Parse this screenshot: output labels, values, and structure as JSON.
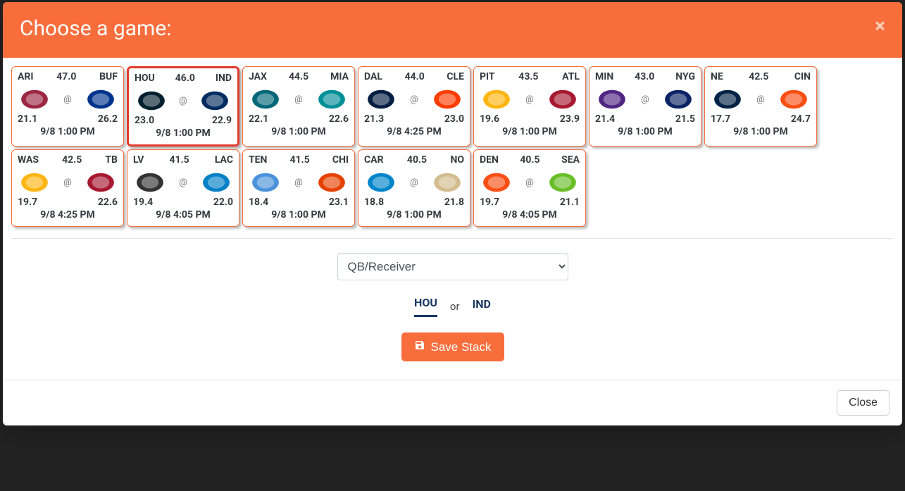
{
  "modal": {
    "title": "Choose a game:",
    "close_x": "×"
  },
  "games": [
    {
      "away": "ARI",
      "home": "BUF",
      "total": "47.0",
      "away_pts": "21.1",
      "home_pts": "26.2",
      "time": "9/8 1:00 PM",
      "selected": false,
      "ac": "#9b2743",
      "hc": "#00338d"
    },
    {
      "away": "HOU",
      "home": "IND",
      "total": "46.0",
      "away_pts": "23.0",
      "home_pts": "22.9",
      "time": "9/8 1:00 PM",
      "selected": true,
      "ac": "#03202f",
      "hc": "#002c5f"
    },
    {
      "away": "JAX",
      "home": "MIA",
      "total": "44.5",
      "away_pts": "22.1",
      "home_pts": "22.6",
      "time": "9/8 1:00 PM",
      "selected": false,
      "ac": "#006778",
      "hc": "#008e97"
    },
    {
      "away": "DAL",
      "home": "CLE",
      "total": "44.0",
      "away_pts": "21.3",
      "home_pts": "23.0",
      "time": "9/8 4:25 PM",
      "selected": false,
      "ac": "#041e42",
      "hc": "#ff3c00"
    },
    {
      "away": "PIT",
      "home": "ATL",
      "total": "43.5",
      "away_pts": "19.6",
      "home_pts": "23.9",
      "time": "9/8 1:00 PM",
      "selected": false,
      "ac": "#ffb612",
      "hc": "#a71930"
    },
    {
      "away": "MIN",
      "home": "NYG",
      "total": "43.0",
      "away_pts": "21.4",
      "home_pts": "21.5",
      "time": "9/8 1:00 PM",
      "selected": false,
      "ac": "#4f2683",
      "hc": "#0b2265"
    },
    {
      "away": "NE",
      "home": "CIN",
      "total": "42.5",
      "away_pts": "17.7",
      "home_pts": "24.7",
      "time": "9/8 1:00 PM",
      "selected": false,
      "ac": "#002244",
      "hc": "#fb4f14"
    },
    {
      "away": "WAS",
      "home": "TB",
      "total": "42.5",
      "away_pts": "19.7",
      "home_pts": "22.6",
      "time": "9/8 4:25 PM",
      "selected": false,
      "ac": "#ffb612",
      "hc": "#a71930"
    },
    {
      "away": "LV",
      "home": "LAC",
      "total": "41.5",
      "away_pts": "19.4",
      "home_pts": "22.0",
      "time": "9/8 4:05 PM",
      "selected": false,
      "ac": "#333333",
      "hc": "#0080c6"
    },
    {
      "away": "TEN",
      "home": "CHI",
      "total": "41.5",
      "away_pts": "18.4",
      "home_pts": "23.1",
      "time": "9/8 1:00 PM",
      "selected": false,
      "ac": "#4b92db",
      "hc": "#e64100"
    },
    {
      "away": "CAR",
      "home": "NO",
      "total": "40.5",
      "away_pts": "18.8",
      "home_pts": "21.8",
      "time": "9/8 1:00 PM",
      "selected": false,
      "ac": "#0085ca",
      "hc": "#d3bc8d"
    },
    {
      "away": "DEN",
      "home": "SEA",
      "total": "40.5",
      "away_pts": "19.7",
      "home_pts": "21.1",
      "time": "9/8 4:05 PM",
      "selected": false,
      "ac": "#fb4f14",
      "hc": "#69be28"
    }
  ],
  "at_symbol": "@",
  "stack_select": {
    "selected": "QB/Receiver"
  },
  "team_tabs": {
    "left": "HOU",
    "or": "or",
    "right": "IND",
    "active": "HOU"
  },
  "buttons": {
    "save": "Save Stack",
    "close": "Close"
  }
}
